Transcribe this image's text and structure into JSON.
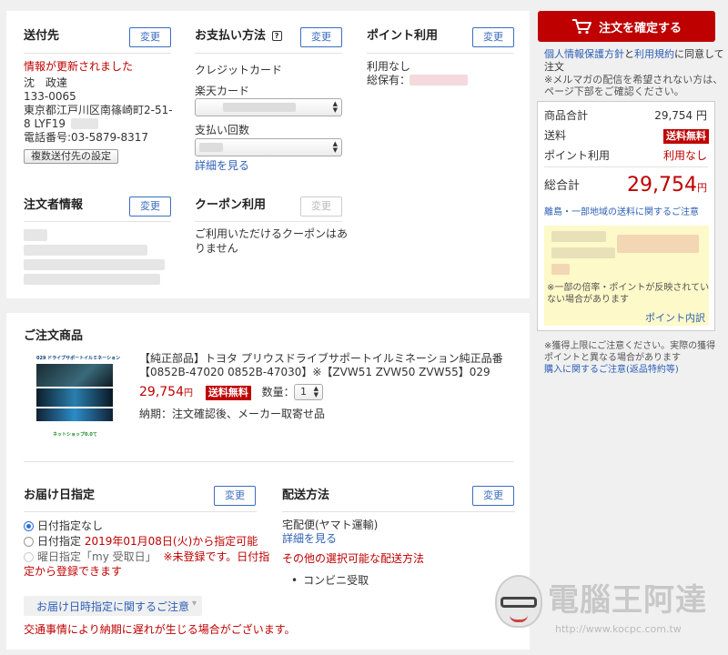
{
  "shipping": {
    "title": "送付先",
    "change": "変更",
    "updated_notice": "情報が更新されました",
    "name": "沈　政達",
    "postal": "133-0065",
    "address_line1": "東京都江戸川区南篠崎町2-51-",
    "address_line2": "8 LYF19",
    "phone": "電話番号:03-5879-8317",
    "multi_button": "複数送付先の設定"
  },
  "payment": {
    "title": "お支払い方法",
    "help_icon": "?",
    "change": "変更",
    "method": "クレジットカード",
    "card_label": "楽天カード",
    "installment_label": "支払い回数",
    "details_link": "詳細を見る"
  },
  "points": {
    "title": "ポイント利用",
    "change": "変更",
    "usage": "利用なし",
    "holding_label": "総保有："
  },
  "orderer": {
    "title": "注文者情報",
    "change": "変更"
  },
  "coupon": {
    "title": "クーポン利用",
    "change": "変更",
    "message_line1": "ご利用いただけるクーポンはあ",
    "message_line2": "りません"
  },
  "items": {
    "title": "ご注文商品",
    "product": {
      "image_caption": "029 ドライブサポートイルミネーション",
      "image_footer": "ネットショップ0.0て",
      "name_line1": "【純正部品】トヨタ プリウスドライブサポートイルミネーション純正品番",
      "name_line2": "【0852B-47020 0852B-47030】※【ZVW51 ZVW50 ZVW55】029",
      "price": "29,754",
      "price_unit": "円",
      "shipping_badge": "送料無料",
      "quantity_label": "数量：",
      "quantity": "1",
      "delivery_note": "納期：注文確認後、メーカー取寄せ品"
    }
  },
  "delivery_date": {
    "title": "お届け日指定",
    "change": "変更",
    "option_none": "日付指定なし",
    "option_date_prefix": "日付指定",
    "option_date_value": "2019年01月08日(火)から指定可能",
    "option_weekday_prefix": "曜日指定「my 受取日」",
    "option_weekday_warning_1": "※未登録です。日付指",
    "option_weekday_warning_2": "定から登録できます",
    "notice_button": "お届け日時指定に関するご注意",
    "traffic_notice": "交通事情により納期に遅れが生じる場合がございます。"
  },
  "delivery_method": {
    "title": "配送方法",
    "change": "変更",
    "carrier": "宅配便(ヤマト運輸)",
    "details_link": "詳細を見る",
    "other_options": "その他の選択可能な配送方法",
    "option_konbini": "コンビニ受取"
  },
  "sidebar": {
    "confirm_button": "注文を確定する",
    "agree_link1": "個人情報保護方針",
    "agree_and": "と",
    "agree_link2": "利用規約",
    "agree_suffix": "に同意して",
    "agree_line2": "注文",
    "mailmag_line1": "※メルマガの配信を希望されない方は、",
    "mailmag_line2": "ページ下部をご確認ください。",
    "subtotal_label": "商品合計",
    "subtotal_value": "29,754 円",
    "shipping_label": "送料",
    "shipping_value": "送料無料",
    "points_label": "ポイント利用",
    "points_value": "利用なし",
    "total_label": "総合計",
    "total_value": "29,754",
    "total_unit": "円",
    "remote_link": "離島・一部地域の送料に関するご注意",
    "points_note_line1": "※一部の倍率・ポイントが反映されてい",
    "points_note_line2": "ない場合があります",
    "points_detail_link": "ポイント内訳",
    "cap_note_line1": "※獲得上限にご注意ください。実際の獲得",
    "cap_note_line2": "ポイントと異なる場合があります",
    "purchase_link": "購入に関するご注意(返品特約等)"
  },
  "watermark": {
    "title": "電腦王阿達",
    "url": "http://www.kocpc.com.tw"
  }
}
